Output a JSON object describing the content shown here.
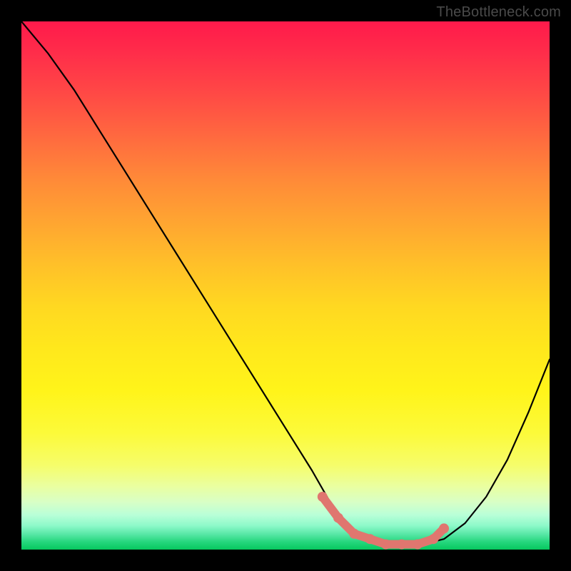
{
  "watermark": "TheBottleneck.com",
  "chart_data": {
    "type": "line",
    "title": "",
    "xlabel": "",
    "ylabel": "",
    "xlim": [
      0,
      100
    ],
    "ylim": [
      0,
      100
    ],
    "series": [
      {
        "name": "bottleneck-curve",
        "x": [
          0,
          5,
          10,
          15,
          20,
          25,
          30,
          35,
          40,
          45,
          50,
          55,
          59,
          62,
          65,
          68,
          72,
          76,
          80,
          84,
          88,
          92,
          96,
          100
        ],
        "values": [
          100,
          94,
          87,
          79,
          71,
          63,
          55,
          47,
          39,
          31,
          23,
          15,
          8,
          4,
          2,
          1,
          1,
          1,
          2,
          5,
          10,
          17,
          26,
          36
        ]
      }
    ],
    "highlight": {
      "name": "optimal-range",
      "color": "#e0766f",
      "x": [
        57,
        60,
        63,
        66,
        69,
        72,
        75,
        78,
        80
      ],
      "values": [
        10,
        6,
        3,
        2,
        1,
        1,
        1,
        2,
        4
      ]
    }
  }
}
